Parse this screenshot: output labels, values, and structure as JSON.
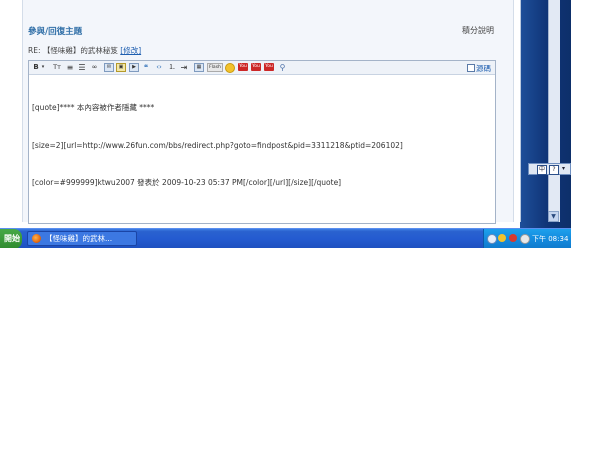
{
  "page": {
    "title": "參與/回復主題",
    "help_link": "積分說明",
    "subject_prefix": "RE: 【怪味雞】的武林秘笈",
    "edit_label": "[修改]"
  },
  "editor": {
    "source_toggle_label": "源碼",
    "toolbar": {
      "bold": "B",
      "font": "Tт",
      "flash": "Flash",
      "youtube": "You"
    },
    "content_lines": [
      "[quote]**** 本內容被作者隱藏 ****",
      "[size=2][url=http://www.26fun.com/bbs/redirect.php?goto=findpost&pid=3311218&ptid=206102]",
      "[color=#999999]ktwu2007 發表於 2009-10-23 05:37 PM[/color][/url][/size][/quote]"
    ]
  },
  "ime_bar": {
    "btn1": "中",
    "btn2": "?"
  },
  "taskbar": {
    "start_label": "開始",
    "task_label": "【怪味雞】的武林...",
    "clock": "下午 08:34"
  }
}
